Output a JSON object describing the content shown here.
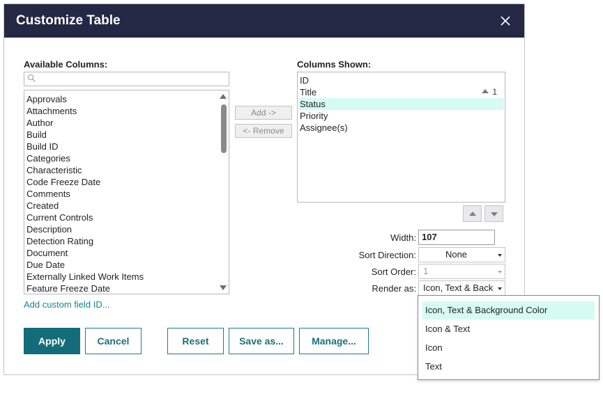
{
  "dialog": {
    "title": "Customize Table",
    "close_icon": "close-icon"
  },
  "available": {
    "label": "Available Columns:",
    "search_placeholder": "",
    "items": [
      "Approvals",
      "Attachments",
      "Author",
      "Build",
      "Build ID",
      "Categories",
      "Characteristic",
      "Code Freeze Date",
      "Comments",
      "Created",
      "Current Controls",
      "Description",
      "Detection Rating",
      "Document",
      "Due Date",
      "Externally Linked Work Items",
      "Feature Freeze Date"
    ],
    "add_custom_link": "Add custom field ID..."
  },
  "transfer": {
    "add_label": "Add ->",
    "remove_label": "<- Remove"
  },
  "shown": {
    "label": "Columns Shown:",
    "items": [
      "ID",
      "Title",
      "Status",
      "Priority",
      "Assignee(s)"
    ],
    "selected": "Status",
    "title_sort_order": "1"
  },
  "props": {
    "width_label": "Width:",
    "width_value": "107",
    "sort_direction_label": "Sort Direction:",
    "sort_direction_value": "None",
    "sort_order_label": "Sort Order:",
    "sort_order_value": "1",
    "render_as_label": "Render as:",
    "render_as_value": "Icon, Text & Backg"
  },
  "render_options": [
    "Icon, Text & Background Color",
    "Icon & Text",
    "Icon",
    "Text"
  ],
  "buttons": {
    "apply": "Apply",
    "cancel": "Cancel",
    "reset": "Reset",
    "save_as": "Save as...",
    "manage": "Manage..."
  },
  "colors": {
    "titlebar": "#242844",
    "accent": "#136c7a",
    "selection": "#d6fcf1",
    "link": "#14868f"
  }
}
